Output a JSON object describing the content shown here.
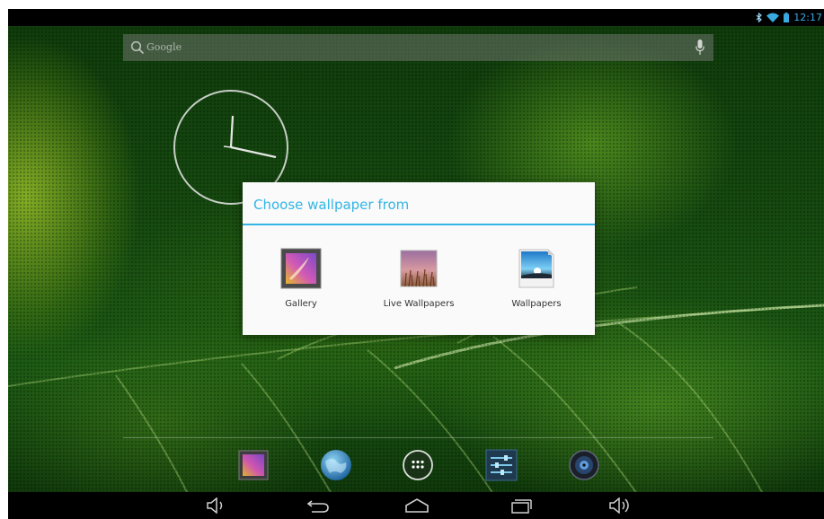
{
  "status_bar": {
    "time": "12:17",
    "icons": [
      "bluetooth-icon",
      "wifi-icon",
      "battery-icon"
    ]
  },
  "search_bar": {
    "hint": "Google",
    "icons": [
      "search-icon",
      "mic-icon"
    ]
  },
  "clock_widget": {
    "type": "analog-clock",
    "hands": [
      "hour-hand",
      "minute-hand"
    ]
  },
  "dialog": {
    "title": "Choose wallpaper from",
    "options": [
      {
        "label": "Gallery",
        "icon": "gallery-icon"
      },
      {
        "label": "Live Wallpapers",
        "icon": "live-wallpapers-icon"
      },
      {
        "label": "Wallpapers",
        "icon": "wallpapers-icon"
      }
    ]
  },
  "dock": {
    "items": [
      "gallery-app-icon",
      "browser-globe-icon",
      "all-apps-icon",
      "settings-app-icon",
      "music-app-icon"
    ]
  },
  "nav_bar": {
    "buttons": [
      "volume-down-icon",
      "back-icon",
      "home-icon",
      "recent-apps-icon",
      "volume-up-icon"
    ]
  },
  "colors": {
    "accent": "#33b5e5",
    "status_time": "#39a9e0",
    "dialog_background": "#fafafa"
  }
}
